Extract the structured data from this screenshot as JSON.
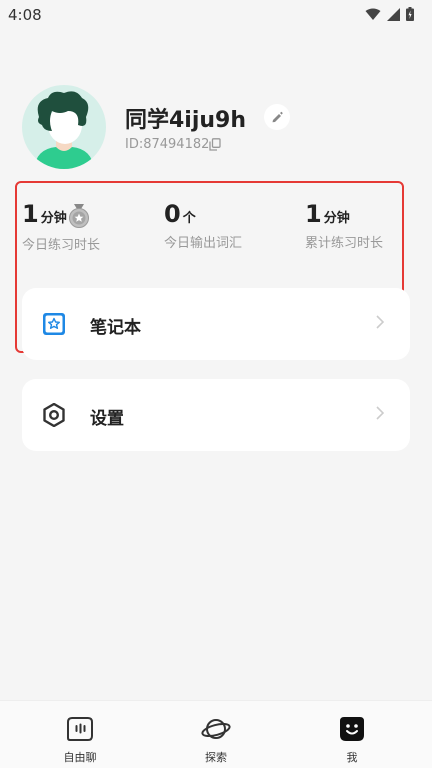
{
  "status": {
    "time": "4:08"
  },
  "profile": {
    "name": "同学4iju9h",
    "id_text": "ID:87494182"
  },
  "stats": [
    {
      "value": "1",
      "unit": "分钟",
      "label": "今日练习时长"
    },
    {
      "value": "0",
      "unit": "个",
      "label": "今日输出词汇"
    },
    {
      "value": "1",
      "unit": "分钟",
      "label": "累计练习时长"
    }
  ],
  "menu": [
    {
      "label": "笔记本",
      "icon": "star-notebook-icon"
    },
    {
      "label": "设置",
      "icon": "hexagon-settings-icon"
    }
  ],
  "nav": [
    {
      "label": "自由聊",
      "icon": "chat-icon"
    },
    {
      "label": "探索",
      "icon": "planet-icon"
    },
    {
      "label": "我",
      "icon": "smiley-icon"
    }
  ],
  "colors": {
    "highlight": "#e53935",
    "accent_blue": "#1e88e5",
    "avatar_bg": "#d6efe9",
    "avatar_shirt": "#2ecc8f"
  }
}
